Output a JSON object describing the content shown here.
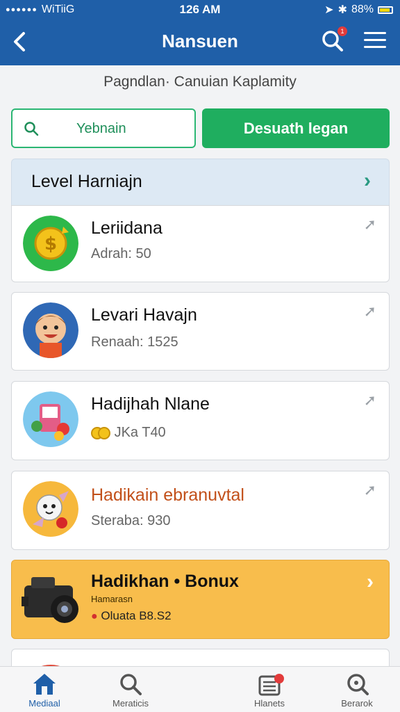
{
  "status_bar": {
    "carrier": "WiTiiG",
    "time": "126 AM",
    "battery": "88%"
  },
  "nav": {
    "title": "Nansuen",
    "badge": "1"
  },
  "subtitle": "Pagndlan·  Canuian Kaplamity",
  "search": {
    "placeholder": "Yebnain"
  },
  "action_button": {
    "label": "Desuath legan"
  },
  "section": {
    "title": "Level Harniajn"
  },
  "cards": [
    {
      "title": "Leriidana",
      "meta": "Adrah: 50"
    },
    {
      "title": "Levari Havajn",
      "meta": "Renaah: 1525"
    },
    {
      "title": "Hadijhah Nlane",
      "meta": "JKa T40"
    },
    {
      "title": "Hadikain ebranuvtal",
      "meta": "Steraba: 930"
    },
    {
      "title": "Hadikhan • Bonux",
      "sub": "Hamarasn",
      "meta": "Oluata B8.S2"
    }
  ],
  "tabs": [
    {
      "label": "Mediaal"
    },
    {
      "label": "Meraticis"
    },
    {
      "label": "Hlanets"
    },
    {
      "label": "Berarok"
    }
  ],
  "colors": {
    "primary": "#1f5fa8",
    "accent_green": "#1fae5f",
    "highlight": "#f8bd4c",
    "badge_red": "#e23b3b"
  }
}
